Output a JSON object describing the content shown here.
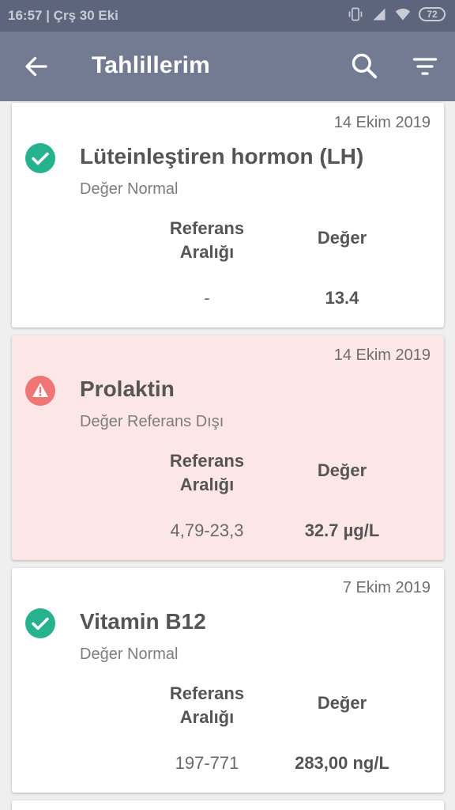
{
  "status_bar": {
    "time": "16:57 | Çrş 30 Eki",
    "battery": "72",
    "icons": [
      "vibrate-icon",
      "signal-icon",
      "wifi-icon",
      "battery-icon"
    ]
  },
  "app_bar": {
    "title": "Tahlillerim",
    "icons": [
      "back-arrow-icon",
      "search-icon",
      "filter-icon"
    ],
    "color": "#737b93"
  },
  "column_headers": {
    "reference": "Referans\nAralığı",
    "value": "Değer"
  },
  "colors": {
    "normal": "#26b28f",
    "warning": "#f07575",
    "warning_bg": "#fde6e6"
  },
  "results": [
    {
      "date": "14 Ekim 2019",
      "name": "Lüteinleştiren hormon (LH)",
      "status": "Değer Normal",
      "status_icon": "check-circle-icon",
      "reference_label": "Referans Aralığı",
      "value_label": "Değer",
      "reference": "-",
      "value": "13.4"
    },
    {
      "date": "14 Ekim 2019",
      "name": "Prolaktin",
      "status": "Değer Referans Dışı",
      "status_icon": "warning-icon",
      "reference_label": "Referans Aralığı",
      "value_label": "Değer",
      "reference": "4,79-23,3",
      "value": "32.7 µg/L"
    },
    {
      "date": "7 Ekim 2019",
      "name": "Vitamin B12",
      "status": "Değer Normal",
      "status_icon": "check-circle-icon",
      "reference_label": "Referans Aralığı",
      "value_label": "Değer",
      "reference": "197-771",
      "value": "283,00 ng/L"
    }
  ]
}
